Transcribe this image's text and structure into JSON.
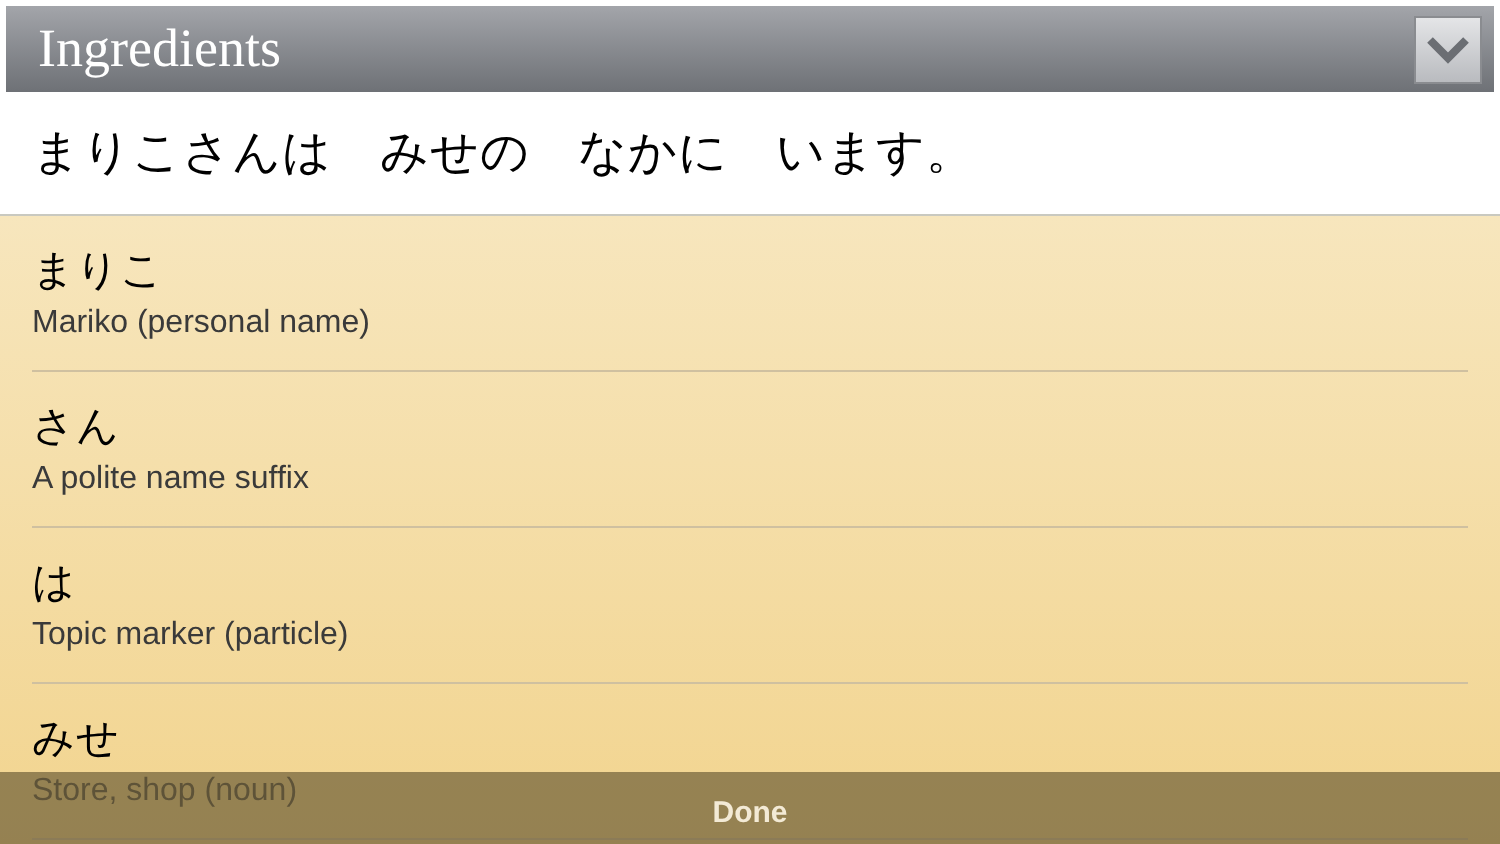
{
  "header": {
    "title": "Ingredients"
  },
  "sentence": "まりこさんは　みせの　なかに　います。",
  "items": [
    {
      "word": "まりこ",
      "meaning": "Mariko (personal name)"
    },
    {
      "word": "さん",
      "meaning": "A polite name suffix"
    },
    {
      "word": "は",
      "meaning": "Topic marker (particle)"
    },
    {
      "word": "みせ",
      "meaning": "Store, shop (noun)"
    }
  ],
  "done_button": "Done"
}
